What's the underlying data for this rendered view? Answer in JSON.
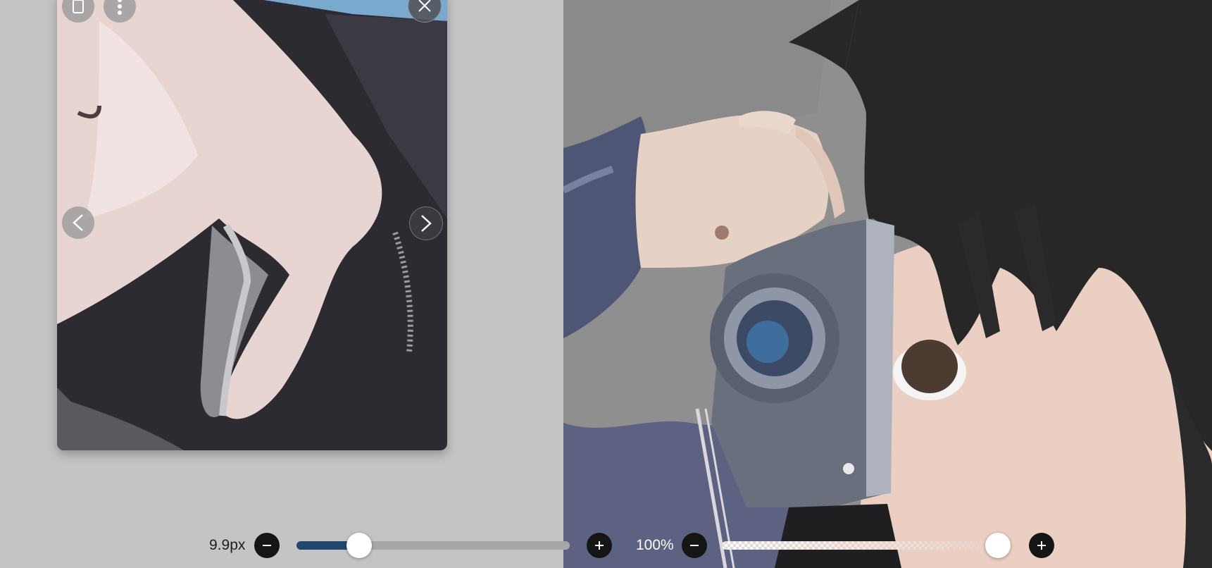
{
  "reference_window": {
    "icons": [
      "layers-icon",
      "more-vertical-icon",
      "close-icon",
      "chevron-left-icon",
      "chevron-right-icon"
    ]
  },
  "toolbar": {
    "brush_size_label": "9.9px",
    "brush_size_fraction": 0.23,
    "opacity_label": "100%",
    "opacity_fraction": 1.0,
    "accent_color": "#23466f"
  }
}
